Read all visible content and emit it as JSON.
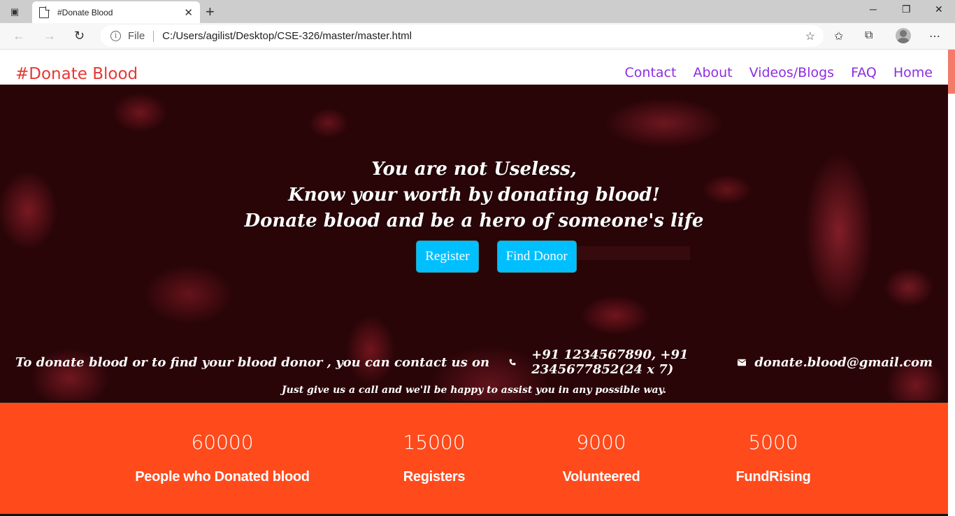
{
  "browser": {
    "tab_title": "#Donate Blood",
    "address_scheme": "File",
    "address_url": "C:/Users/agilist/Desktop/CSE-326/master/master.html"
  },
  "nav": {
    "brand": "#Donate Blood",
    "links": [
      "Contact",
      "About",
      "Videos/Blogs",
      "FAQ",
      "Home"
    ]
  },
  "hero": {
    "tagline": [
      "You are not Useless,",
      "Know your worth by donating blood!",
      "Donate blood and be a hero of someone's life"
    ],
    "register_button": "Register",
    "find_donor_button": "Find Donor",
    "contact_lead": "To donate blood or to find your blood donor , you can contact us on",
    "phones": "+91 1234567890, +91 2345677852(24 x 7)",
    "email": "donate.blood@gmail.com",
    "assist_text": "Just give us a call and we'll be happy to assist you in any possible way."
  },
  "stats": [
    {
      "number": "60000",
      "label": "People who Donated blood"
    },
    {
      "number": "15000",
      "label": "Registers"
    },
    {
      "number": "9000",
      "label": "Volunteered"
    },
    {
      "number": "5000",
      "label": "FundRising"
    }
  ],
  "colors": {
    "brand": "#e53935",
    "nav_link": "#8e2de2",
    "button": "#00bfff",
    "stats_bg": "#ff4a1c"
  }
}
